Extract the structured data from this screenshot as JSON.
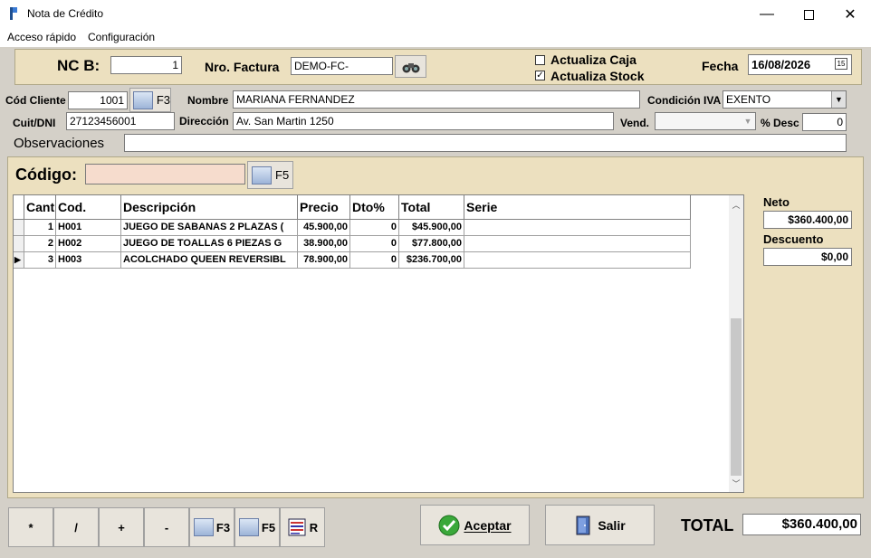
{
  "window": {
    "title": "Nota de Crédito"
  },
  "menu": [
    "Acceso rápido",
    "Configuración"
  ],
  "header": {
    "nc_label": "NC B:",
    "nc_value": "1",
    "factura_label": "Nro. Factura",
    "factura_value": "DEMO-FC-",
    "actualiza_caja": "Actualiza Caja",
    "actualiza_stock": "Actualiza Stock",
    "fecha_label": "Fecha",
    "fecha_value": "16/08/2026"
  },
  "cliente": {
    "cod_label": "Cód Cliente",
    "cod_value": "1001",
    "f3": "F3",
    "nombre_label": "Nombre",
    "nombre_value": "MARIANA FERNANDEZ",
    "iva_label": "Condición IVA",
    "iva_value": "EXENTO",
    "cuit_label": "Cuit/DNI",
    "cuit_value": "27123456001",
    "direccion_label": "Dirección",
    "direccion_value": "Av. San Martin 1250",
    "vend_label": "Vend.",
    "desc_label": "% Desc",
    "desc_value": "0",
    "obs_label": "Observaciones"
  },
  "codigo": {
    "label": "Código:",
    "f5": "F5"
  },
  "grid": {
    "headers": [
      "Cant",
      "Cod.",
      "Descripción",
      "Precio",
      "Dto%",
      "Total",
      "Serie"
    ],
    "rows": [
      {
        "cant": "1",
        "cod": "H001",
        "desc": "JUEGO DE SABANAS 2 PLAZAS (",
        "precio": "45.900,00",
        "dto": "0",
        "total": "$45.900,00",
        "serie": ""
      },
      {
        "cant": "2",
        "cod": "H002",
        "desc": "JUEGO DE TOALLAS 6 PIEZAS G",
        "precio": "38.900,00",
        "dto": "0",
        "total": "$77.800,00",
        "serie": ""
      },
      {
        "cant": "3",
        "cod": "H003",
        "desc": "ACOLCHADO QUEEN REVERSIBL",
        "precio": "78.900,00",
        "dto": "0",
        "total": "$236.700,00",
        "serie": ""
      }
    ]
  },
  "totals": {
    "neto_label": "Neto",
    "neto_value": "$360.400,00",
    "descuento_label": "Descuento",
    "descuento_value": "$0,00",
    "total_label": "TOTAL",
    "total_value": "$360.400,00"
  },
  "keypad": [
    "*",
    "/",
    "+",
    "-"
  ],
  "buttons": {
    "f3": "F3",
    "f5": "F5",
    "r": "R",
    "aceptar": "Aceptar",
    "salir": "Salir"
  }
}
